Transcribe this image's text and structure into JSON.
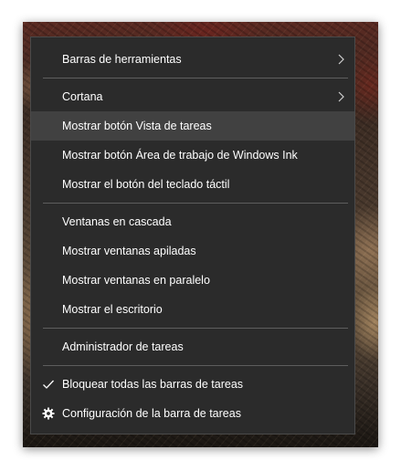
{
  "context_menu": {
    "items": [
      {
        "label": "Barras de herramientas",
        "submenu": true
      },
      {
        "label": "Cortana",
        "submenu": true
      },
      {
        "label": "Mostrar botón Vista de tareas",
        "highlighted": true
      },
      {
        "label": "Mostrar botón Área de trabajo de Windows Ink"
      },
      {
        "label": "Mostrar el botón del teclado táctil"
      },
      {
        "label": "Ventanas en cascada"
      },
      {
        "label": "Mostrar ventanas apiladas"
      },
      {
        "label": "Mostrar ventanas en paralelo"
      },
      {
        "label": "Mostrar el escritorio"
      },
      {
        "label": "Administrador de tareas"
      },
      {
        "label": "Bloquear todas las barras de tareas",
        "checked": true,
        "icon": "checkmark-icon"
      },
      {
        "label": "Configuración de la barra de tareas",
        "icon": "gear-icon"
      }
    ]
  },
  "colors": {
    "menu_background": "#2b2b2b",
    "menu_highlight": "#414141",
    "separator": "#5e5e5e",
    "text": "#ffffff"
  }
}
